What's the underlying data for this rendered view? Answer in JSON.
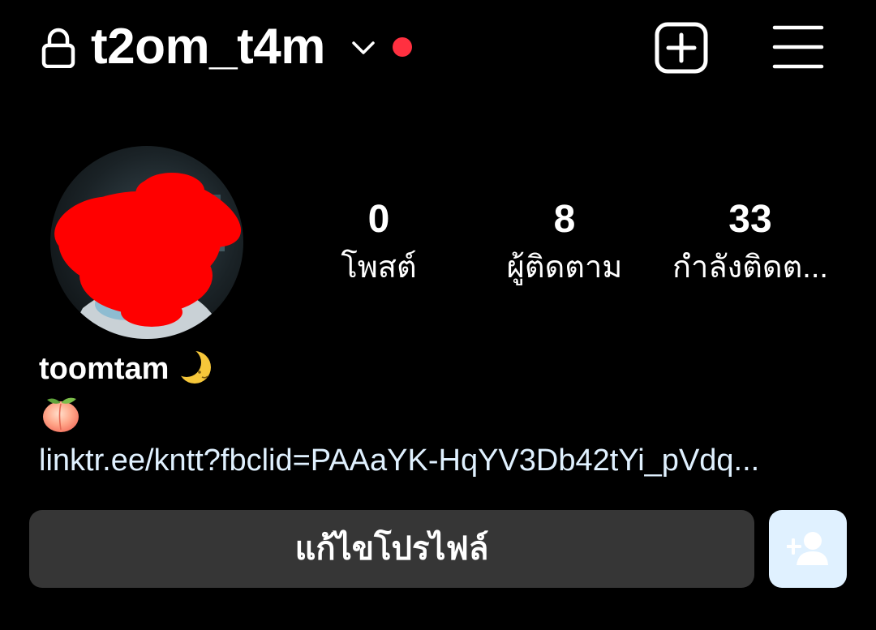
{
  "header": {
    "username": "t2om_t4m",
    "icons": {
      "lock": "lock-icon",
      "account_switcher": "chevron-down-icon",
      "notification": "red-dot",
      "create": "plus-square-icon",
      "menu": "hamburger-menu-icon"
    }
  },
  "profile": {
    "avatar_icon": "avatar-photo-redacted",
    "stats": {
      "posts": {
        "value": "0",
        "label": "โพสต์"
      },
      "followers": {
        "value": "8",
        "label": "ผู้ติดตาม"
      },
      "following": {
        "value": "33",
        "label": "กำลังติดต..."
      }
    },
    "display_name": "toomtam",
    "display_name_emoji": "crescent-moon-icon",
    "bio_emoji": "peach-icon",
    "bio_link": "linktr.ee/kntt?fbclid=PAAaYK-HqYV3Db42tYi_pVdq..."
  },
  "actions": {
    "edit_profile_label": "แก้ไขโปรไฟล์",
    "discover_people_icon": "add-person-icon"
  },
  "colors": {
    "background": "#000000",
    "text": "#ffffff",
    "notification_dot": "#ff3040",
    "button_bg": "#363636",
    "link": "#e0f1ff",
    "discover_button_bg": "#e0f1ff"
  }
}
